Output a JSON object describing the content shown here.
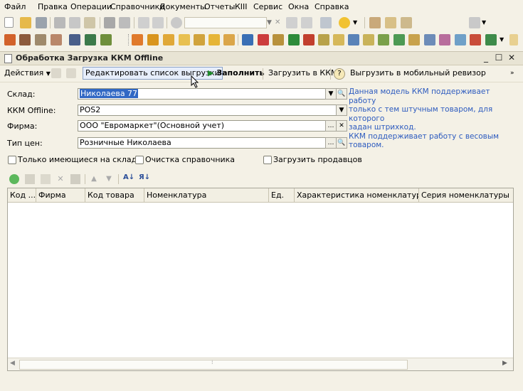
{
  "menu": [
    "Файл",
    "Правка",
    "Операции",
    "Справочники",
    "Документы",
    "Отчеты",
    "КIII",
    "Сервис",
    "Окна",
    "Справка"
  ],
  "toolbar_quick": [
    "М",
    "М+",
    "М-"
  ],
  "window": {
    "title": "Обработка  Загрузка ККМ Offline",
    "min": "_",
    "max": "☐",
    "close": "✕"
  },
  "commands": {
    "actions": "Действия",
    "edit_list": "Редактировать список выгрузки",
    "fill": "Заполнить",
    "load_kkm": "Загрузить в ККМ",
    "upload_mobile": "Выгрузить в мобильный ревизор"
  },
  "form": {
    "warehouse_label": "Склад:",
    "warehouse_value": "Николаева 77",
    "kkm_label": "ККМ Offline:",
    "kkm_value": "POS2",
    "company_label": "Фирма:",
    "company_value": "ООО \"Евромаркет\"(Основной учет)",
    "price_label": "Тип цен:",
    "price_value": "Розничные Николаева",
    "info_lines": [
      "Данная модель ККМ поддерживает работу",
      "только с тем штучным товаром, для которого",
      "задан штрихкод.",
      "ККМ поддерживает работу с весовым товаром."
    ]
  },
  "checkboxes": {
    "only_in_stock": "Только имеющиеся на складе",
    "clear_catalog": "Очистка справочника",
    "load_sellers": "Загрузить продавцов"
  },
  "table": {
    "columns": [
      "Код ...",
      "Фирма",
      "Код товара",
      "Номенклатура",
      "Ед.",
      "Характеристика номенклатуры",
      "Серия номенклатуры"
    ],
    "rows": []
  },
  "colors": {
    "info_text": "#2d5bbf",
    "fill_arrow": "#1f8a2c",
    "selection": "#3168c4"
  }
}
